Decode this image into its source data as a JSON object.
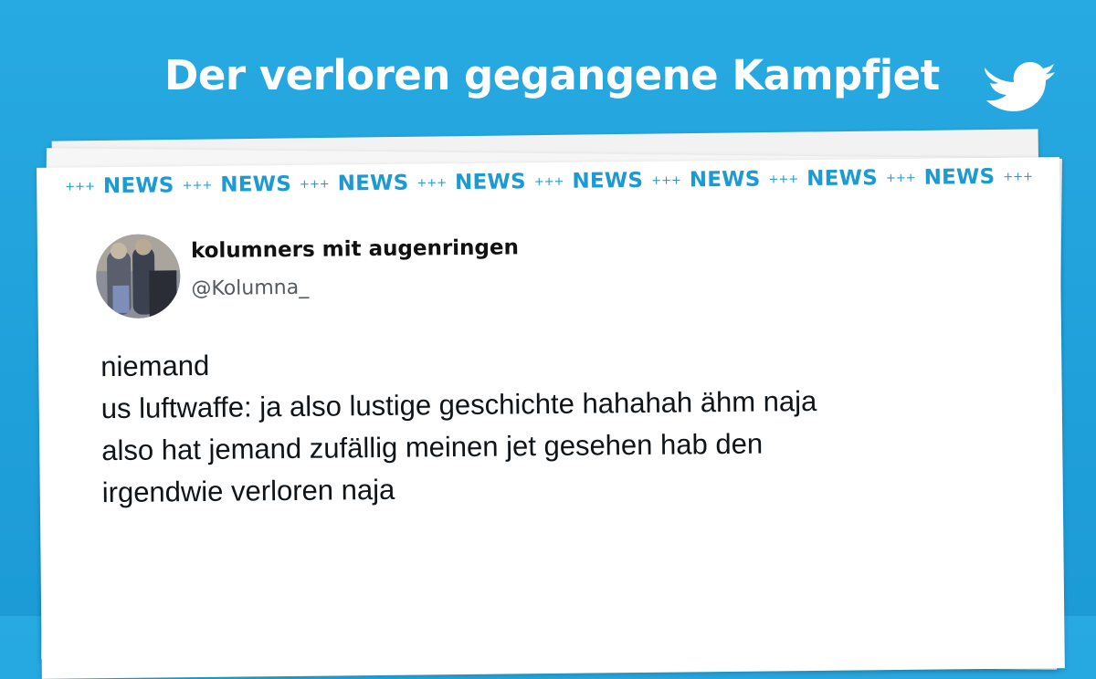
{
  "header": {
    "title": "Der verloren gegangene Kampfjet",
    "logo_icon": "twitter-bird-icon"
  },
  "ticker": {
    "separator": "+++",
    "word": "NEWS",
    "repeat": 8,
    "color": "#1b9ad3"
  },
  "tweet": {
    "display_name": "kolumners mit augenringen",
    "handle": "@Kolumna_",
    "lines": [
      "niemand",
      "us luftwaffe: ja also lustige geschichte hahahah ähm naja",
      "also hat jemand zufällig meinen jet gesehen hab den",
      "irgendwie verloren naja"
    ]
  },
  "colors": {
    "background": "#1c9bd6",
    "headline": "#ffffff",
    "text": "#0f1419",
    "handle": "#555a60"
  }
}
